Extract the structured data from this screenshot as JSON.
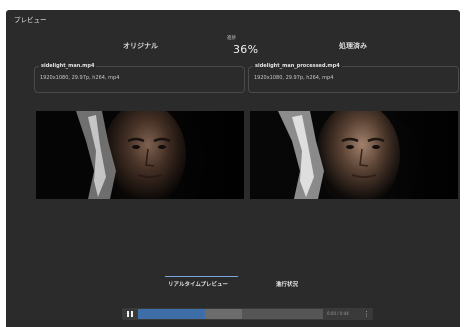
{
  "window": {
    "title": "プレビュー"
  },
  "header": {
    "original_label": "オリジナル",
    "processed_label": "処理済み",
    "progress_caption": "進捗",
    "progress_value": "36%",
    "progress_fraction": 0.36
  },
  "files": {
    "original": {
      "name": "sidelight_man.mp4",
      "info": "1920x1080, 29.97p, h264, mp4"
    },
    "processed": {
      "name": "sidelight_man_processed.mp4",
      "info": "1920x1080, 29.97p, h264, mp4"
    }
  },
  "tabs": [
    {
      "label": "リアルタイムプレビュー",
      "active": true
    },
    {
      "label": "進行状況",
      "active": false
    }
  ],
  "player": {
    "state_icon": "pause-icon",
    "time": "0:00 / 0:44",
    "more_icon": "more-vertical-icon",
    "played_fraction": 0.36,
    "buffered_fraction": 0.56
  },
  "colors": {
    "background": "#2b2b2b",
    "accent": "#3d6ea8",
    "tab_underline": "#7aa6d9"
  }
}
